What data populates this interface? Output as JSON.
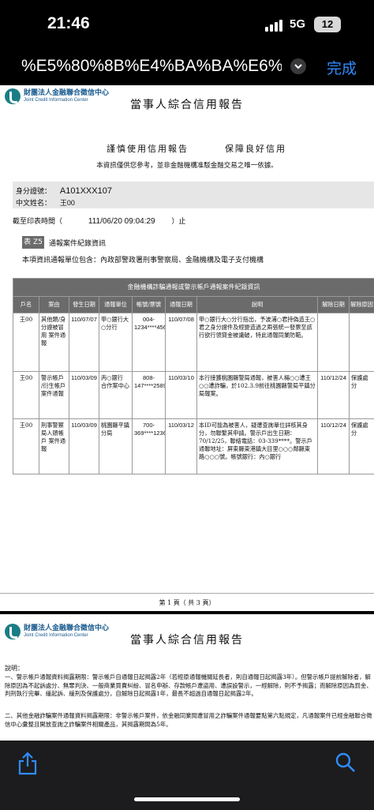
{
  "status": {
    "time": "21:46",
    "network": "5G",
    "battery": "12"
  },
  "urlbar": {
    "url": "%E5%80%8B%E4%BA%BA%E6%",
    "done": "完成"
  },
  "logo": {
    "cn": "財團法人金融聯合徵信中心",
    "en": "Joint Credit Information Center"
  },
  "page1": {
    "title": "當事人綜合信用報告",
    "motto_left": "謹慎使用信用報告",
    "motto_right": "保障良好信用",
    "notice": "本資訊僅供您參考，並非金融機構准駁金融交易之唯一依據。",
    "id_label": "身分證號：",
    "id_value": "A101XXX107",
    "name_label": "中文姓名：",
    "name_value": "王00",
    "print_label": "截至印表時間（",
    "print_value": "111/06/20 09:04:29",
    "print_suffix": "）止",
    "table_tag": "表 Z5",
    "table_name": "通報案件紀錄資訊",
    "report_units": "本項資訊通報單位包含：內政部警政署刑事警察局、金融機構及電子支付機構",
    "grid_caption": "金融機構詐騙通報或警示帳戶通報案件紀錄資訊",
    "headers": [
      "戶名",
      "案由",
      "發生日期",
      "通報單位",
      "帳號/票號",
      "通報日期",
      "說明",
      "解除日期",
      "解除原因"
    ],
    "rows": [
      {
        "name": "王00",
        "reason": "其他類/身分證被冒用 案件通報",
        "occur": "110/07/07",
        "unit": "甲○銀行大○分行",
        "account": "004-1234****4568",
        "notify": "110/07/08",
        "desc": "甲○銀行大○分行指出，予波浦○君持偽造王○君之身分證件及經變造過之兩張統一發票至該行欲行領貸金被識破，特此通報同業防範。",
        "release": "",
        "release_reason": ""
      },
      {
        "name": "王00",
        "reason": "警示帳戶 /衍生帳戶 案件通報",
        "occur": "110/03/09",
        "unit": "丙○銀行 合作案中心",
        "account": "808-147****2589",
        "notify": "110/03/10",
        "desc": "本行接獲桃園縣警局通報，被害人楊○○遭王○○遭詐騙，於102.3.9前往桃園縣警局平鎮分局報案。",
        "release": "110/12/24",
        "release_reason": "保護處分"
      },
      {
        "name": "王00",
        "reason": "刑事警察局人頭帳戶 案件通報",
        "occur": "110/03/09",
        "unit": "桃園縣平鎮分局",
        "account": "700-369****1236",
        "notify": "110/03/12",
        "desc": "本ID可能為被害人，疑遭查詢單位詳核其身分，勿聯繫其申請。警示戶出生日期：70/12/25，聯絡電話：03-339****。警示戶通聯地址：屏東縣東港鎮大目里○○○鄰縣東路○○○號。帳號銀行：內○銀行",
        "release": "110/12/24",
        "release_reason": "保護處分"
      }
    ],
    "footer": "第 1 頁（ 共 3 頁）"
  },
  "page2": {
    "title": "當事人綜合信用報告",
    "label": "說明：",
    "item1": "一、警示帳戶通報資料揭露期限：警示帳戶自通報日起揭露2年（若經原通報機關延長者，則自通報日起揭露3年）。但警示帳戶提前解除者，解除原因為不起訴處分、無罪判決、一般商業買賣糾紛、冒名申辦、存款帳戶遭盜用、遭誤設警示，一經解除，則不予揭露；而解除原因為罰金、判刑執行完畢、緩起訴、緩刑及保護處分，自解除日起揭露1年，最長不超過自通報日起揭露2年。",
    "item2": "二、其他金融詐騙案件通報資料揭露期限：非警示帳戶案件，依金融同業間遭冒用之詐騙案件通報要點第六點規定，凡通報案件已經金融聯合徵信中心彙整且開放查詢之詐騙案件相關產品，其揭露期間為5年。"
  },
  "toolbar": {
    "share_icon": "share-icon",
    "search_icon": "search-icon"
  }
}
